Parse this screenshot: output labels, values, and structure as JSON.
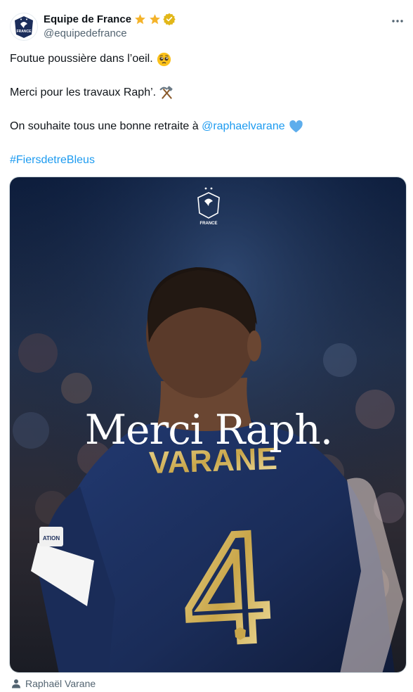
{
  "account": {
    "display_name": "Equipe de France",
    "handle": "@equipedefrance",
    "badges": [
      "star-icon",
      "star-icon",
      "verified-icon"
    ],
    "avatar_text": "FRANCE"
  },
  "tweet": {
    "line1": "Foutue poussière dans l’oeil.",
    "line1_emoji": "pleading-face-emoji",
    "line2": "Merci pour les travaux Raph’.",
    "line2_emoji": "hammer-and-pick-emoji",
    "line3_prefix": "On souhaite tous une bonne retraite à ",
    "line3_mention": "@raphaelvarane",
    "line3_emoji": "blue-heart-emoji",
    "hashtag": "#FiersdetreBleus"
  },
  "media": {
    "logo_text": "FRANCE",
    "headline": "Merci Raph.",
    "jersey_name": "VARANE",
    "jersey_number": "4",
    "armband_text": "ATION"
  },
  "caption": {
    "tagged_person": "Raphaël Varane"
  },
  "colors": {
    "link": "#1d9bf0",
    "secondary_text": "#536471",
    "jersey_blue": "#1b2d5a",
    "gold": "#c9a64a"
  }
}
